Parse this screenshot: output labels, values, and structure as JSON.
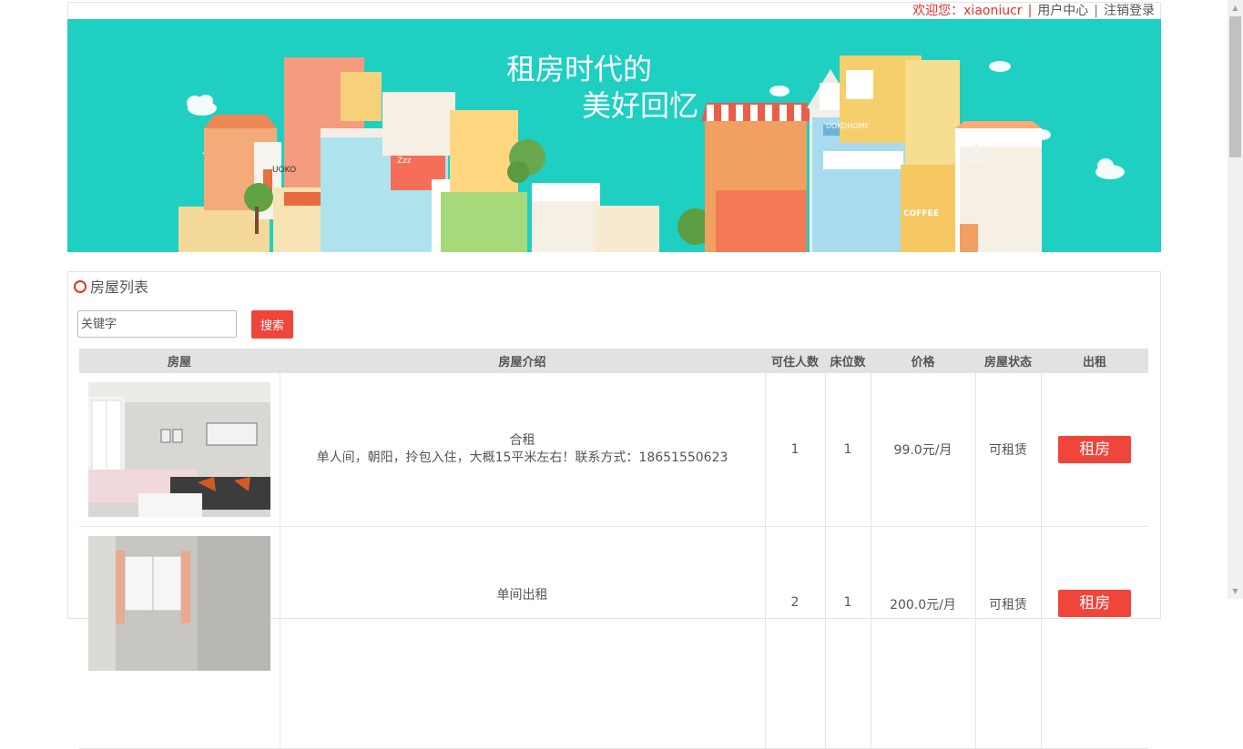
{
  "header": {
    "welcome": "欢迎您：xiaoniucr",
    "separator": "|",
    "user_center": "用户中心",
    "logout": "注销登录"
  },
  "banner": {
    "heading_line1": "租房时代的",
    "heading_line2": "美好回忆",
    "sign_uoko": "UOKO",
    "sign_uokohome": "UOKOHOME",
    "sign_coffee": "COFFEE",
    "sign_zzz": "Zzz"
  },
  "panel": {
    "title": "房屋列表",
    "search_placeholder": "关键字",
    "search_button": "搜索"
  },
  "table": {
    "columns": [
      "房屋",
      "房屋介绍",
      "可住人数",
      "床位数",
      "价格",
      "房屋状态",
      "出租"
    ],
    "rows": [
      {
        "title": "合租",
        "description": "单人间，朝阳，拎包入住，大概15平米左右！联系方式：18651550623",
        "capacity": "1",
        "beds": "1",
        "price": "99.0元/月",
        "status": "可租赁",
        "action": "租房"
      },
      {
        "title": "单间出租",
        "description": "",
        "capacity": "2",
        "beds": "1",
        "price": "200.0元/月",
        "status": "可租赁",
        "action": "租房"
      }
    ]
  },
  "colors": {
    "accent": "#f0453a",
    "banner_bg": "#1fcfc2",
    "header_bg": "#e2e2e2"
  }
}
